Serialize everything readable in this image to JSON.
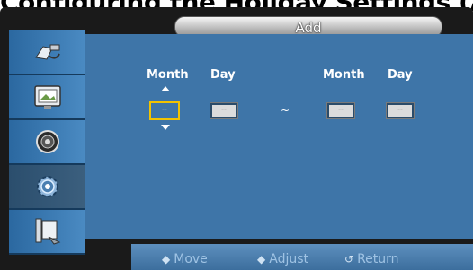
{
  "header": {
    "cut_heading": "Configuring the Holiday Settings (Add)"
  },
  "window": {
    "title": "Add"
  },
  "sidebar": {
    "items": [
      {
        "icon": "input-source-icon"
      },
      {
        "icon": "picture-icon"
      },
      {
        "icon": "sound-icon"
      },
      {
        "icon": "setup-gear-icon",
        "active": true
      },
      {
        "icon": "multi-control-icon"
      }
    ]
  },
  "form": {
    "start_month_label": "Month",
    "start_day_label": "Day",
    "end_month_label": "Month",
    "end_day_label": "Day",
    "start_month_value": "--",
    "start_day_value": "--",
    "end_month_value": "--",
    "end_day_value": "--",
    "separator": "~"
  },
  "footer": {
    "move_label": "Move",
    "adjust_label": "Adjust",
    "return_label": "Return"
  }
}
